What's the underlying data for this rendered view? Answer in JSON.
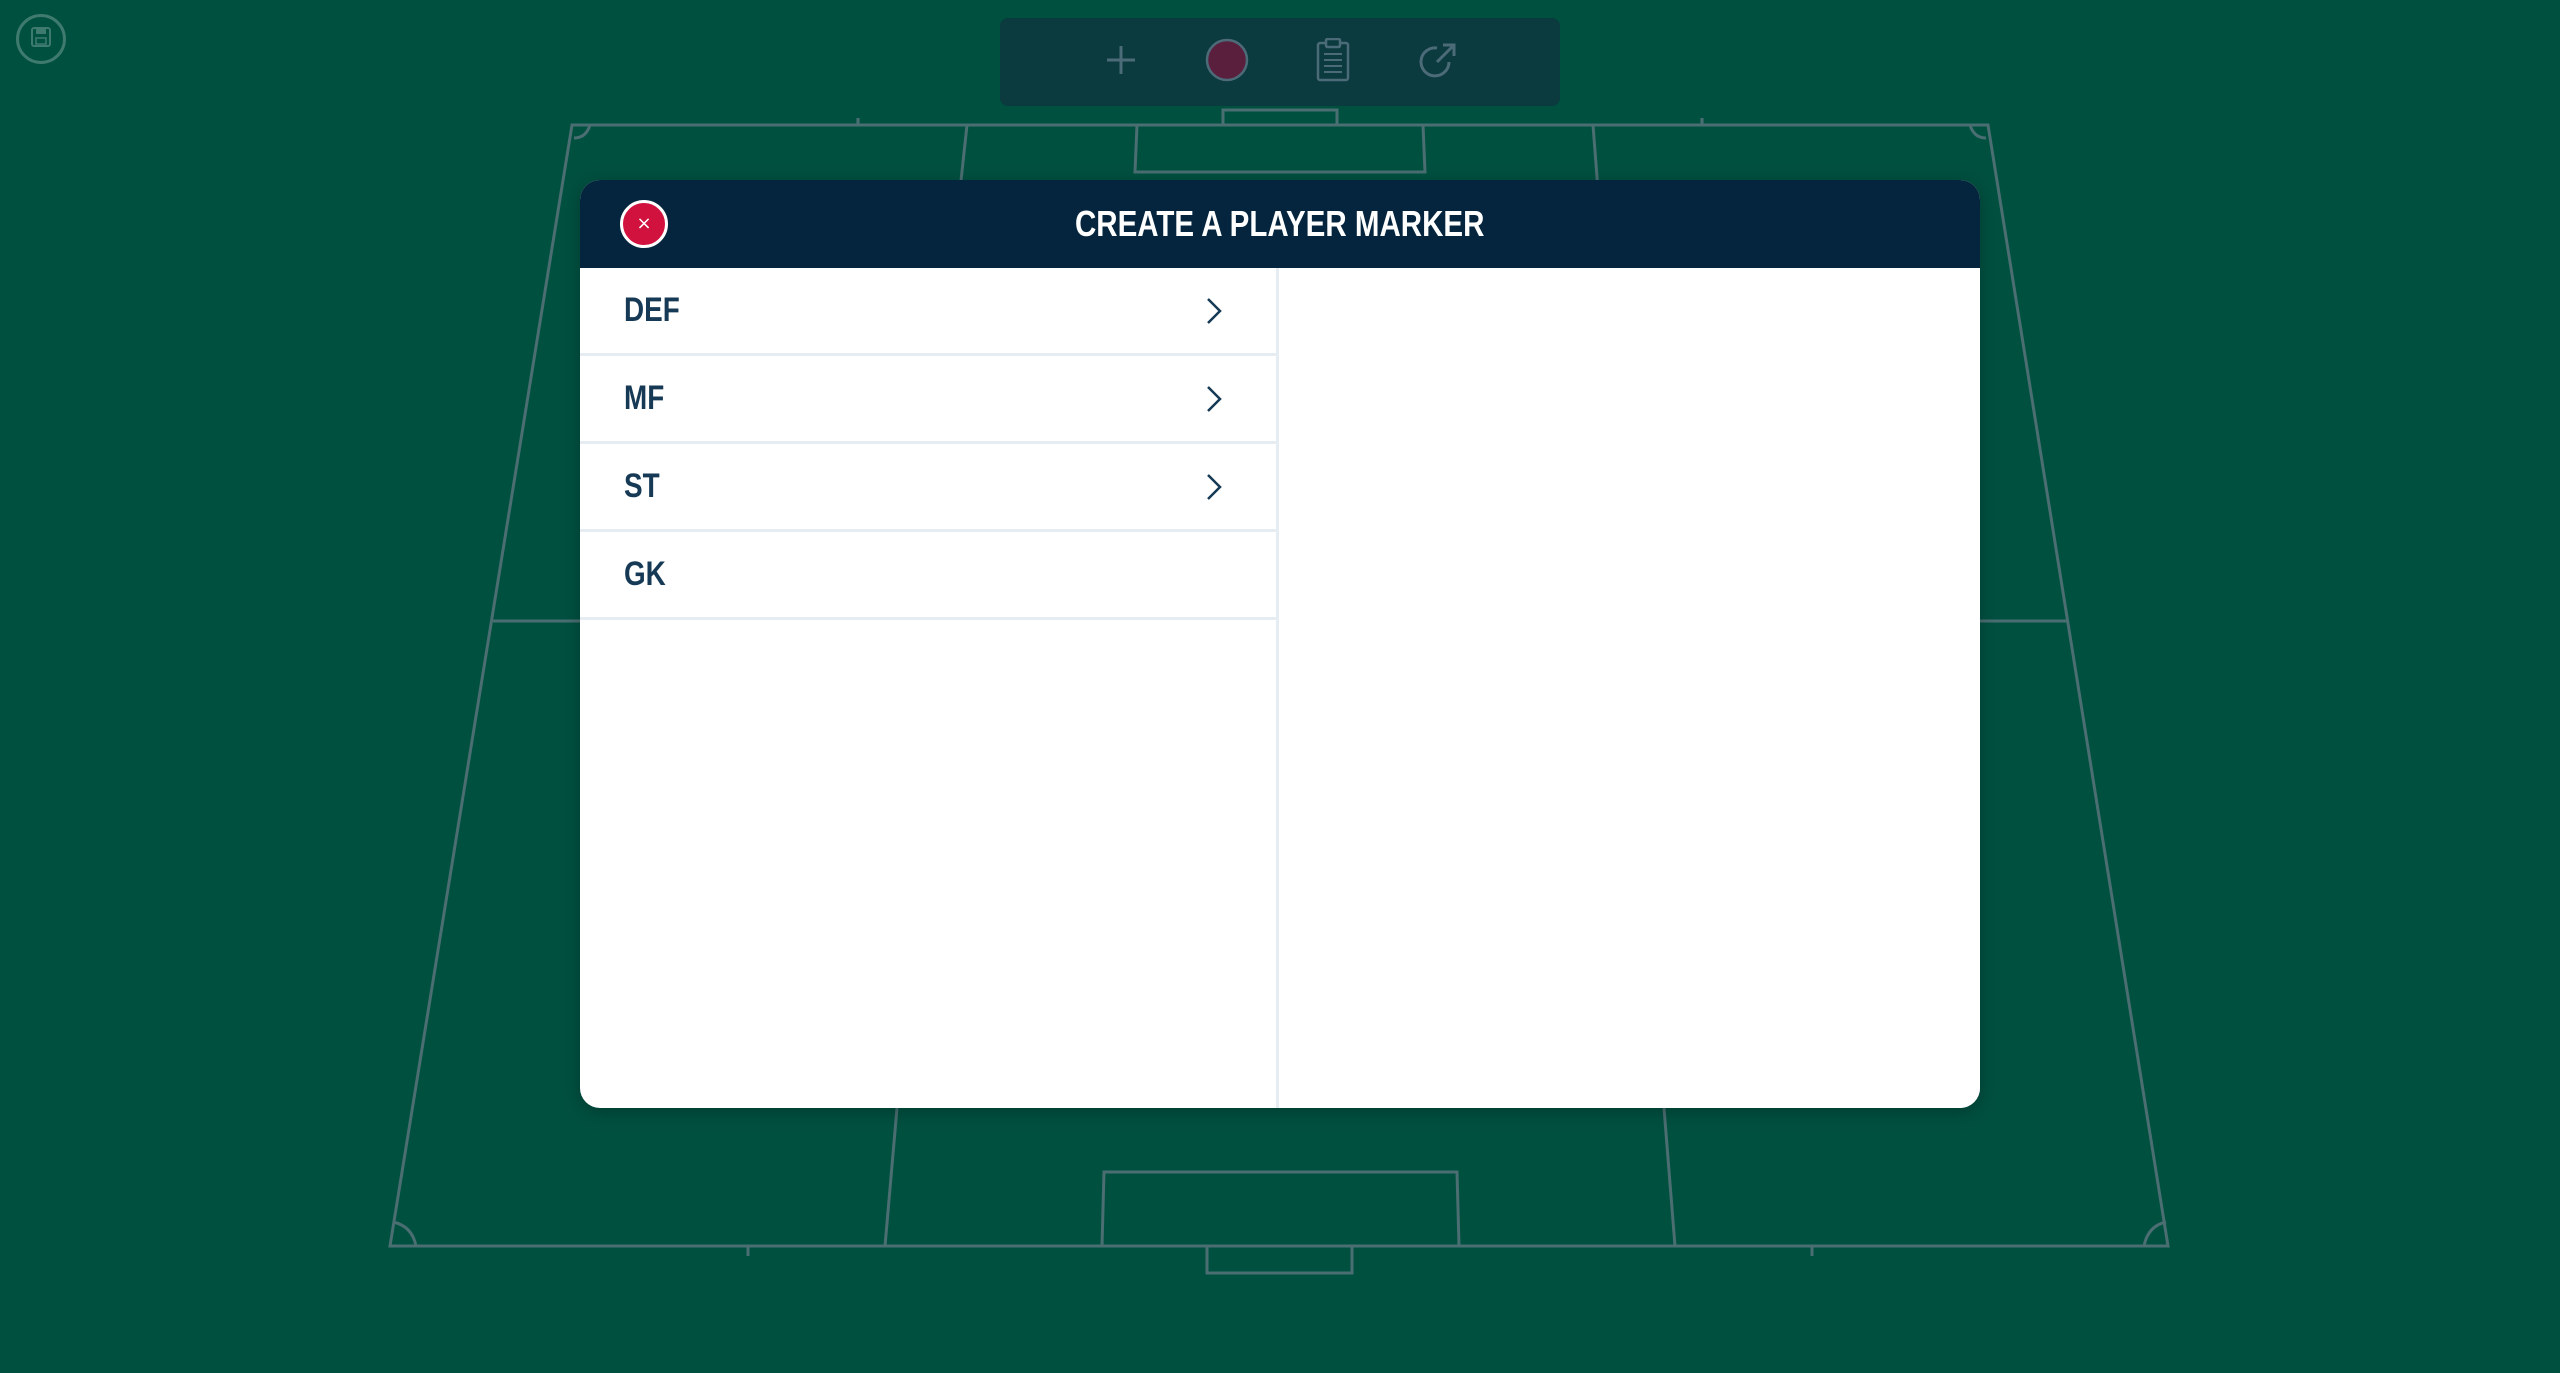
{
  "toolbar": {
    "items": [
      {
        "name": "add-icon"
      },
      {
        "name": "color-swatch-icon",
        "color": "#5a1f3d"
      },
      {
        "name": "clipboard-icon"
      },
      {
        "name": "share-icon"
      }
    ]
  },
  "save_button": {
    "icon": "save-icon"
  },
  "dialog": {
    "title": "CREATE A PLAYER MARKER",
    "close_icon": "×",
    "categories": [
      {
        "label": "DEF",
        "has_submenu": true
      },
      {
        "label": "MF",
        "has_submenu": true
      },
      {
        "label": "ST",
        "has_submenu": true
      },
      {
        "label": "GK",
        "has_submenu": false
      }
    ]
  },
  "colors": {
    "background": "#005040",
    "pitch_line": "#4a6e72",
    "toolbar": "#0b3a3f",
    "dialog_header": "#04253d",
    "close_button": "#d1123f",
    "text_dark": "#163a55"
  }
}
